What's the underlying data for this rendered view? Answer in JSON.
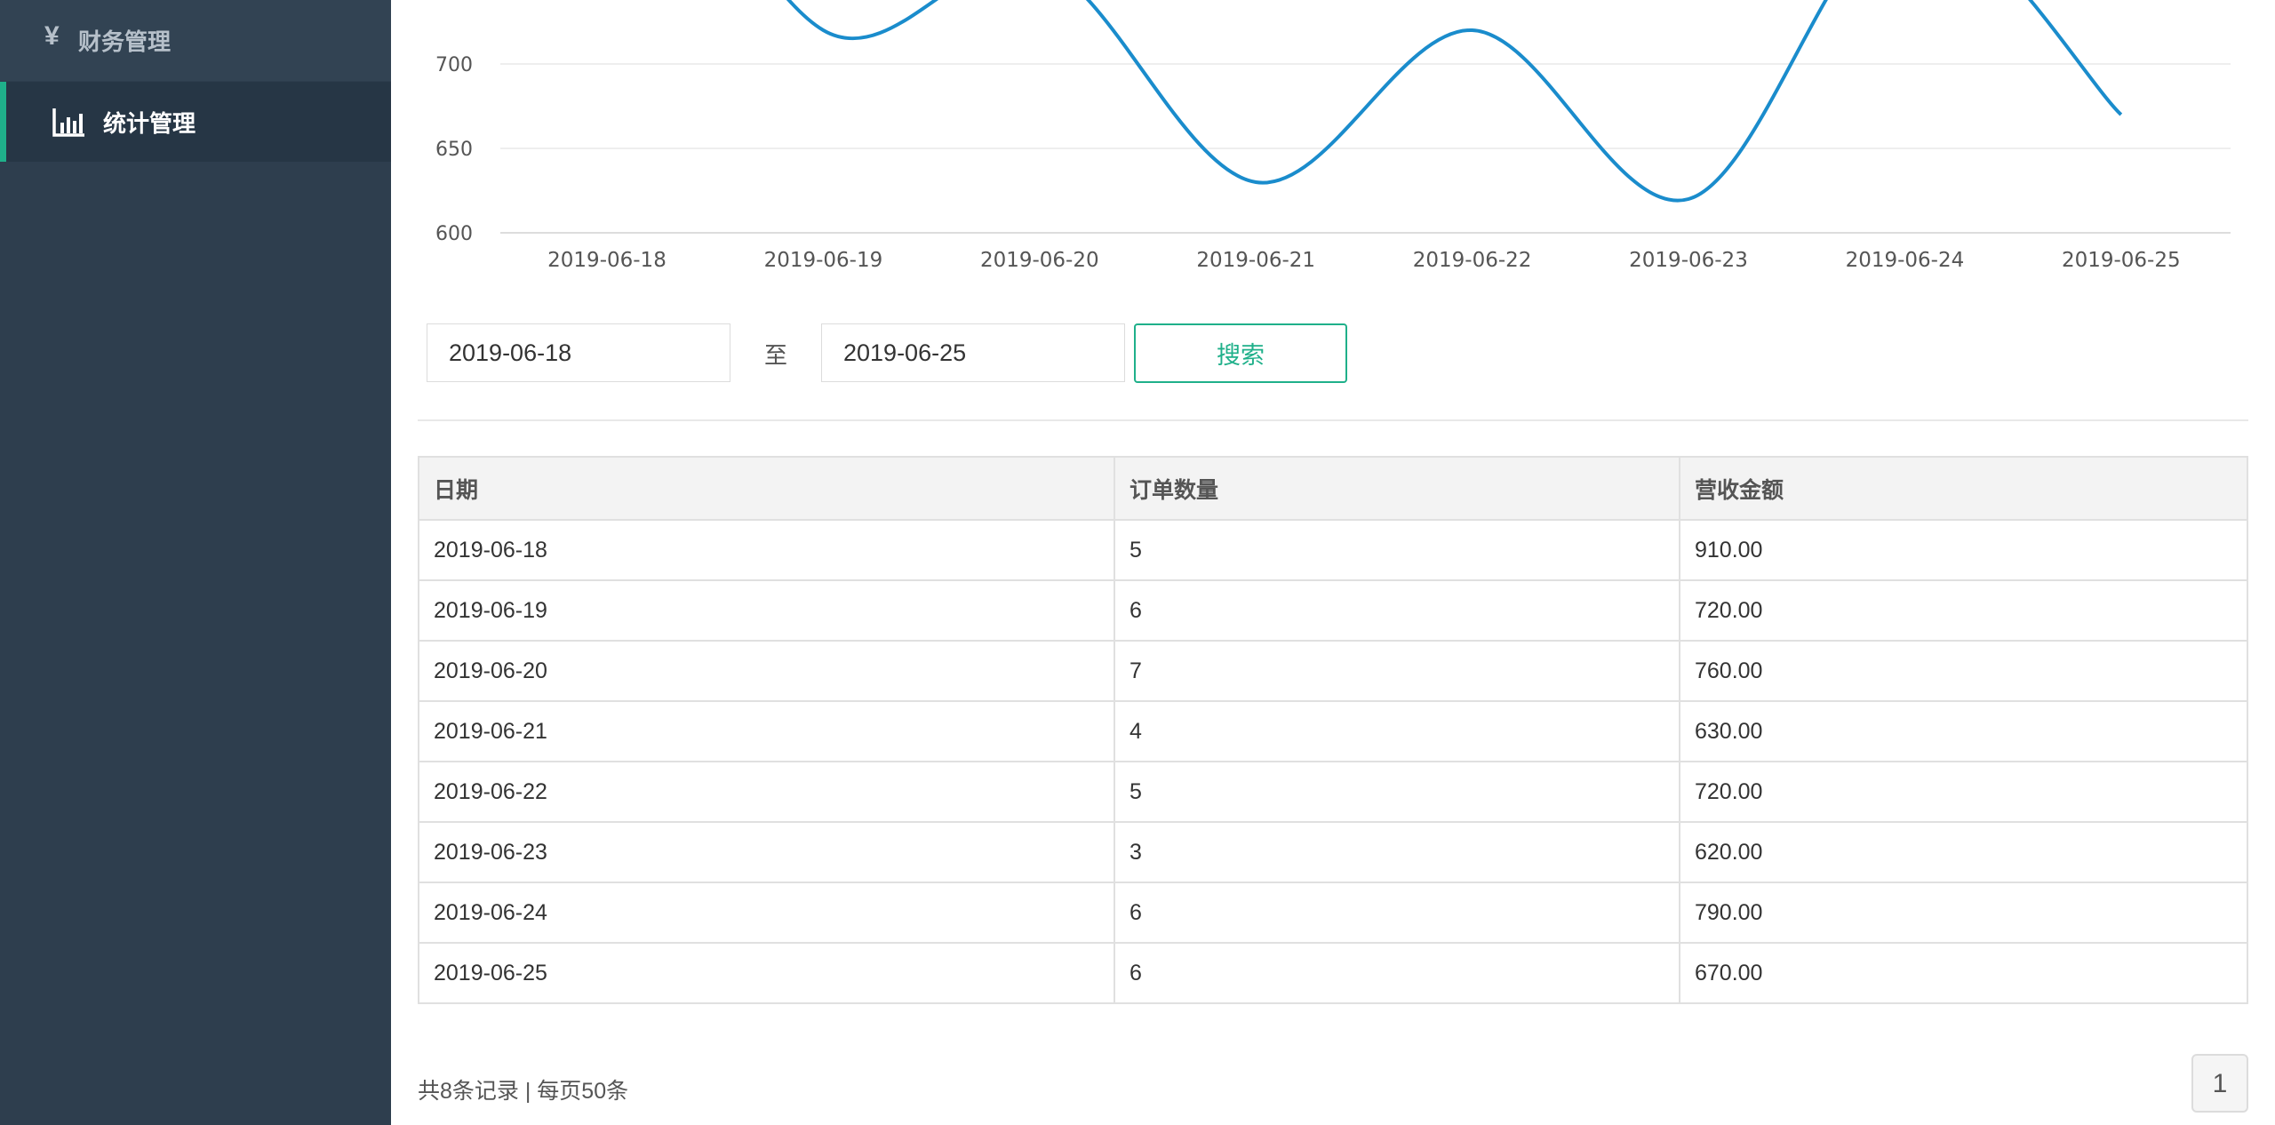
{
  "sidebar": {
    "items": [
      {
        "label": "财务管理",
        "icon": "yen-icon"
      },
      {
        "label": "统计管理",
        "icon": "bar-chart-icon",
        "active": true
      }
    ]
  },
  "colors": {
    "sidebar_bg": "#2e3e4e",
    "active_bg": "#263645",
    "accent": "#1fb08a",
    "line": "#1a8ccc"
  },
  "chart_data": {
    "type": "line",
    "x": [
      "2019-06-18",
      "2019-06-19",
      "2019-06-20",
      "2019-06-21",
      "2019-06-22",
      "2019-06-23",
      "2019-06-24",
      "2019-06-25"
    ],
    "series": [
      {
        "values": [
          910,
          720,
          760,
          630,
          720,
          620,
          790,
          670
        ]
      }
    ],
    "y_ticks": [
      600,
      650,
      700
    ],
    "grid": true
  },
  "search": {
    "from": "2019-06-18",
    "to": "2019-06-25",
    "to_label": "至",
    "button": "搜索"
  },
  "table": {
    "headers": [
      "日期",
      "订单数量",
      "营收金额"
    ],
    "rows": [
      [
        "2019-06-18",
        "5",
        "910.00"
      ],
      [
        "2019-06-19",
        "6",
        "720.00"
      ],
      [
        "2019-06-20",
        "7",
        "760.00"
      ],
      [
        "2019-06-21",
        "4",
        "630.00"
      ],
      [
        "2019-06-22",
        "5",
        "720.00"
      ],
      [
        "2019-06-23",
        "3",
        "620.00"
      ],
      [
        "2019-06-24",
        "6",
        "790.00"
      ],
      [
        "2019-06-25",
        "6",
        "670.00"
      ]
    ]
  },
  "pagination": {
    "info": "共8条记录 | 每页50条",
    "current_page": "1"
  }
}
